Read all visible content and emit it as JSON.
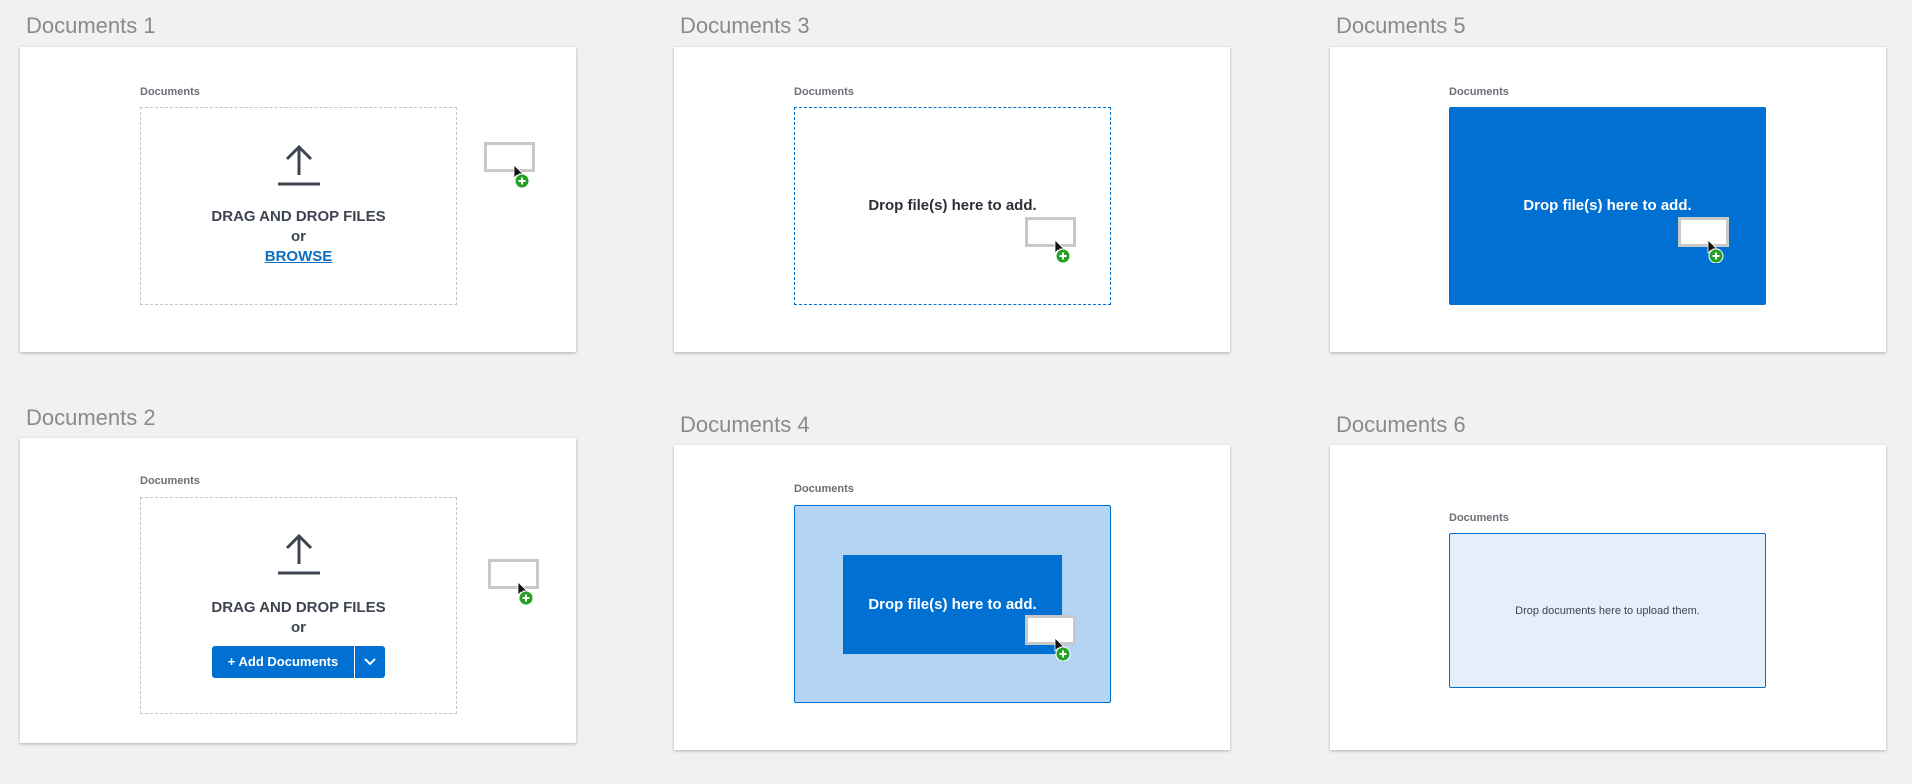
{
  "panels": [
    {
      "title": "Documents 1",
      "label": "Documents",
      "line1": "DRAG AND DROP FILES",
      "line2": "or",
      "link": "BROWSE"
    },
    {
      "title": "Documents 2",
      "label": "Documents",
      "line1": "DRAG AND DROP FILES",
      "line2": "or",
      "button": "+ Add Documents"
    },
    {
      "title": "Documents 3",
      "label": "Documents",
      "drop": "Drop file(s) here to add."
    },
    {
      "title": "Documents 4",
      "label": "Documents",
      "drop": "Drop file(s) here to add."
    },
    {
      "title": "Documents 5",
      "label": "Documents",
      "drop": "Drop file(s) here to add."
    },
    {
      "title": "Documents 6",
      "label": "Documents",
      "drop": "Drop documents here to upload them."
    }
  ],
  "icons": {
    "upload": "upload-arrow-icon",
    "cursor": "cursor-arrow-icon",
    "add_badge": "plus-badge-icon",
    "dropdown": "chevron-down-icon"
  },
  "colors": {
    "brand": "#0070d2",
    "drop_highlight": "#b3d5f3",
    "drop_idle": "#e5eff9",
    "plus_badge": "#22a022"
  }
}
